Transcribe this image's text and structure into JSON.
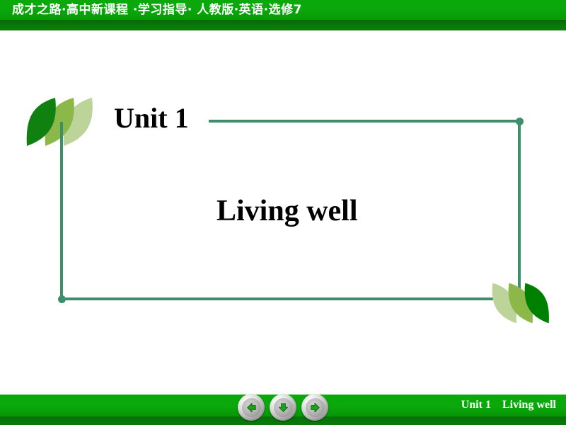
{
  "header": {
    "title": "成才之路·高中新课程 ·学习指导· 人教版·英语·选修7",
    "bg_color": "#0aa80a",
    "shadow_color": "#046904"
  },
  "slide": {
    "unit_label": "Unit 1",
    "lesson_title": "Living well",
    "frame_color": "#3d8f6b",
    "crescent_colors": {
      "dark": "#108010",
      "medium": "#8cb84a",
      "light": "#bcd49a"
    }
  },
  "footer": {
    "label": "Unit 1    Living well",
    "bg_color": "#0aa80a",
    "shadow_color": "#057205",
    "buttons": [
      {
        "name": "previous-slide-button",
        "icon": "arrow-left-icon",
        "direction": "left"
      },
      {
        "name": "next-animation-button",
        "icon": "arrow-down-icon",
        "direction": "down"
      },
      {
        "name": "next-slide-button",
        "icon": "arrow-right-icon",
        "direction": "right"
      }
    ]
  }
}
